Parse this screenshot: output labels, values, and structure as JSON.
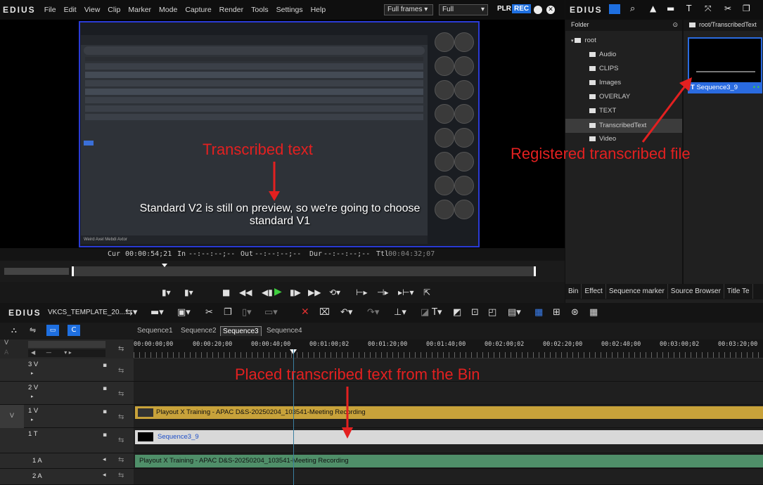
{
  "app": {
    "logo": "EDIUS",
    "menu": [
      "File",
      "Edit",
      "View",
      "Clip",
      "Marker",
      "Mode",
      "Capture",
      "Render",
      "Tools",
      "Settings",
      "Help"
    ],
    "frames_dropdown": "Full frames",
    "quality_dropdown": "Full",
    "plr_label": "PLR",
    "rec_label": "REC"
  },
  "preview": {
    "overlay_text_line1": "Standard V2 is still on preview, so we're going to choose",
    "overlay_text_line2": "standard V1",
    "caption_left": "Transcribed text",
    "meeting_footer": "Weird Axel Mebdi Axtor"
  },
  "timecode": {
    "cur_label": "Cur",
    "cur": "00:00:54;21",
    "in_label": "In",
    "in": "--:--:--;--",
    "out_label": "Out",
    "out": "--:--:--;--",
    "dur_label": "Dur",
    "dur": "--:--:--;--",
    "ttl_label": "Ttl",
    "ttl": "00:04:32;07"
  },
  "bin": {
    "logo": "EDIUS",
    "folder_header": "Folder",
    "clip_path": "root/TranscribedText",
    "folders": [
      "root",
      "Audio",
      "CLIPS",
      "Images",
      "OVERLAY",
      "TEXT",
      "TranscribedText",
      "Video"
    ],
    "clip_name": "Sequence3_9",
    "annotation": "Registered transcribed file",
    "tabs": [
      "Bin",
      "Effect",
      "Sequence marker",
      "Source Browser",
      "Title Te"
    ]
  },
  "timeline": {
    "logo": "EDIUS",
    "project_name": "VKCS_TEMPLATE_20...",
    "sequence_tabs": [
      "Sequence1",
      "Sequence2",
      "Sequence3",
      "Sequence4"
    ],
    "active_sequence": "Sequence3",
    "ruler_ticks": [
      "00:00:00;00",
      "00:00:20;00",
      "00:00:40;00",
      "00:01:00;02",
      "00:01:20;00",
      "00:01:40;00",
      "00:02:00;02",
      "00:02:20;00",
      "00:02:40;00",
      "00:03:00;02",
      "00:03:20;00"
    ],
    "tracks": [
      {
        "label": "3 V"
      },
      {
        "label": "2 V"
      },
      {
        "label": "1 V",
        "side": "V"
      },
      {
        "label": "1 T"
      },
      {
        "label": "1 A"
      },
      {
        "label": "2 A"
      }
    ],
    "clip_video": "Playout X Training - APAC D&S-20250204_103541-Meeting Recording",
    "clip_title": "Sequence3_9",
    "clip_audio": "Playout X Training - APAC D&S-20250204_103541-Meeting Recording",
    "annotation": "Placed transcribed text from the Bin",
    "header_v": "V",
    "header_a": "A"
  },
  "colors": {
    "annotation_red": "#e32020",
    "video_clip": "#c8a23a",
    "title_clip": "#d8d8d8",
    "audio_clip": "#4f8f69",
    "selection_blue": "#2a6be0"
  }
}
